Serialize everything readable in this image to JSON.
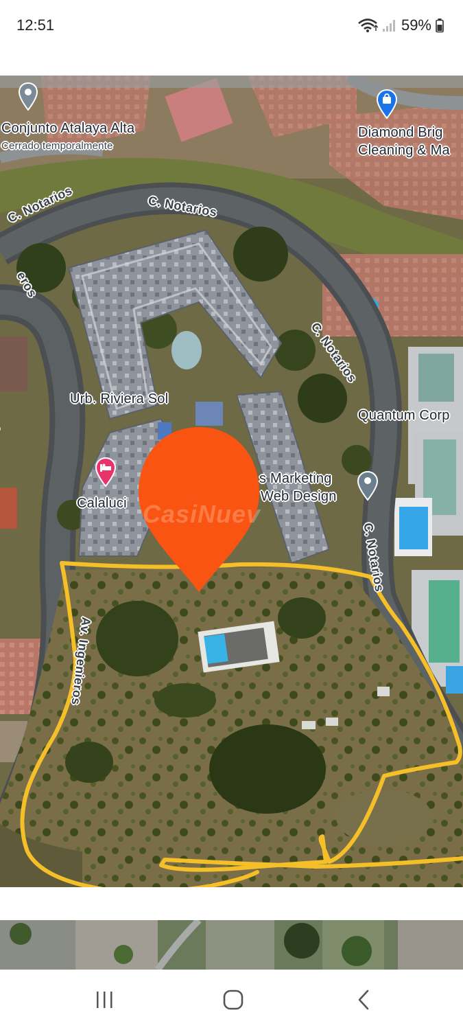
{
  "status_bar": {
    "time": "12:51",
    "battery": "59%",
    "icons": [
      "wifi-icon",
      "signal-icon",
      "battery-icon"
    ]
  },
  "map": {
    "places": {
      "atalaya_title": "Conjunto Atalaya Alta",
      "atalaya_sub": "Cerrado temporalmente",
      "diamond_line1": "Diamond Brig",
      "diamond_line2": "Cleaning & Ma",
      "riviera": "Urb. Riviera Sol",
      "quantum": "Quantum Corp",
      "marketing_line1": "s Marketing",
      "marketing_line2": "Web Design",
      "calaluci": "Calaluci"
    },
    "streets": {
      "notarios_1": "C. Notarios",
      "notarios_2": "C. Notarios",
      "notarios_3": "C. Notarios",
      "notarios_4": "C. Notarios",
      "ingenieros": "Av. Ingenieros",
      "eros": "eros",
      "s": "s"
    },
    "watermark": "CasiNuev",
    "marker_color": "#fa5412",
    "outline_color": "#f5bf2a"
  },
  "nav_bar": {
    "buttons": [
      "recents-button",
      "home-button",
      "back-button"
    ]
  }
}
